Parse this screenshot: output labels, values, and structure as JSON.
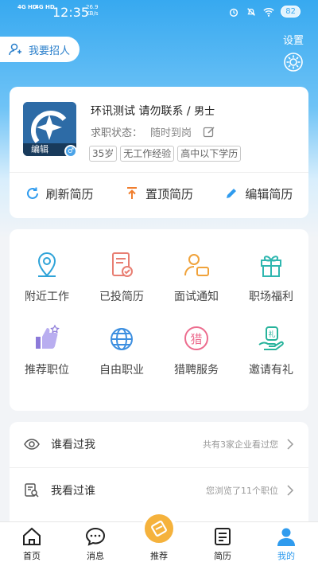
{
  "status_bar": {
    "net1": "4G HD",
    "net2": "4G HD",
    "time": "12:35",
    "speed_value": "26.9",
    "speed_unit": "KB/s",
    "battery": "82"
  },
  "header": {
    "recruit_label": "我要招人",
    "settings_label": "设置"
  },
  "profile": {
    "avatar_edit_label": "编辑",
    "name": "环讯测试 请勿联系",
    "gender": "男士",
    "status_label": "求职状态：",
    "status_value": "随时到岗",
    "tags": [
      "35岁",
      "无工作经验",
      "高中以下学历"
    ],
    "actions": [
      {
        "label": "刷新简历",
        "icon": "refresh-icon"
      },
      {
        "label": "置顶简历",
        "icon": "pin-top-icon"
      },
      {
        "label": "编辑简历",
        "icon": "pencil-icon"
      }
    ]
  },
  "grid": {
    "items": [
      {
        "label": "附近工作",
        "icon": "location-pin-icon"
      },
      {
        "label": "已投简历",
        "icon": "resume-check-icon"
      },
      {
        "label": "面试通知",
        "icon": "interview-chat-icon"
      },
      {
        "label": "职场福利",
        "icon": "gift-icon"
      },
      {
        "label": "推荐职位",
        "icon": "thumbs-up-icon"
      },
      {
        "label": "自由职业",
        "icon": "globe-icon"
      },
      {
        "label": "猎聘服务",
        "icon": "hunt-service-icon"
      },
      {
        "label": "邀请有礼",
        "icon": "gift-hand-icon"
      }
    ]
  },
  "list": {
    "items": [
      {
        "title": "谁看过我",
        "subtitle": "共有3家企业看过您",
        "icon": "eye-icon"
      },
      {
        "title": "我看过谁",
        "subtitle": "您浏览了11个职位",
        "icon": "search-doc-icon"
      }
    ]
  },
  "tabbar": {
    "tabs": [
      {
        "label": "首页",
        "icon": "home-icon"
      },
      {
        "label": "消息",
        "icon": "message-icon"
      },
      {
        "label": "推荐",
        "icon": "recommend-icon"
      },
      {
        "label": "简历",
        "icon": "resume-icon"
      },
      {
        "label": "我的",
        "icon": "profile-icon"
      }
    ],
    "active": "我的"
  },
  "colors": {
    "accent": "#2f9bee",
    "center_button": "#f5b23c",
    "top_gradient": "#37a9f0"
  }
}
